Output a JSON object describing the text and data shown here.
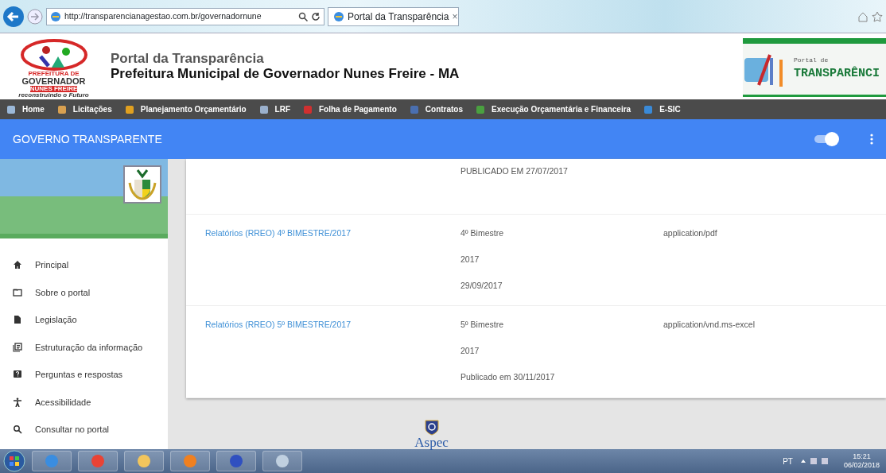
{
  "browser": {
    "address": "http://transparencianagestao.com.br/governadornune",
    "tab": {
      "title": "Portal da Transparência",
      "close": "×"
    }
  },
  "header": {
    "logo_text": [
      "PREFEITURA DE",
      "GOVERNADOR",
      "NUNES FREIRE",
      "reconstruindo o Futuro"
    ],
    "title": "Portal da Transparência",
    "subtitle": "Prefeitura Municipal de Governador Nunes Freire - MA",
    "badge": {
      "small": "Portal de",
      "big": "TRANSPARÊNCI"
    }
  },
  "menu": [
    {
      "label": "Home"
    },
    {
      "label": "Licitações"
    },
    {
      "label": "Planejamento Orçamentário"
    },
    {
      "label": "LRF"
    },
    {
      "label": "Folha de Pagamento"
    },
    {
      "label": "Contratos"
    },
    {
      "label": "Execução Orçamentária e Financeira"
    },
    {
      "label": "E-SIC"
    }
  ],
  "appbar": {
    "title": "GOVERNO TRANSPARENTE",
    "toggle": {
      "on": true
    }
  },
  "sidebar": {
    "items": [
      {
        "label": "Principal"
      },
      {
        "label": "Sobre o portal"
      },
      {
        "label": "Legislação"
      },
      {
        "label": "Estruturação da informação"
      },
      {
        "label": "Perguntas e respostas"
      },
      {
        "label": "Acessibilidade"
      },
      {
        "label": "Consultar no portal"
      }
    ]
  },
  "table": {
    "rows": [
      {
        "link": "",
        "details": [
          "PUBLICADO EM 27/07/2017"
        ],
        "type": ""
      },
      {
        "link": "Relatórios (RREO) 4º BIMESTRE/2017",
        "details": [
          "4º Bimestre",
          "2017",
          "29/09/2017"
        ],
        "type": "application/pdf"
      },
      {
        "link": "Relatórios (RREO) 5º BIMESTRE/2017",
        "details": [
          "5º Bimestre",
          "2017",
          "Publicado em 30/11/2017"
        ],
        "type": "application/vnd.ms-excel"
      }
    ]
  },
  "footer": {
    "logo": "Aspec"
  },
  "taskbar": {
    "language": "PT",
    "time": "15:21",
    "date": "06/02/2018"
  }
}
